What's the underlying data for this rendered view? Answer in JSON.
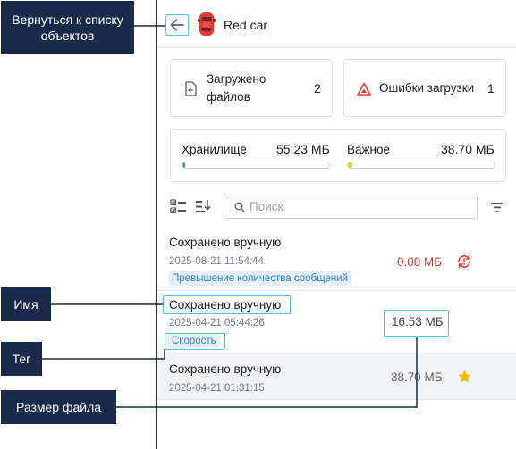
{
  "header": {
    "title": "Red car",
    "back_icon": "arrow-left-icon",
    "object_icon": "red-car-icon"
  },
  "stats": {
    "uploaded": {
      "label": "Загружено файлов",
      "count": "2",
      "icon": "file-upload-icon"
    },
    "errors": {
      "label": "Ошибки загрузки",
      "count": "1",
      "icon": "warning-triangle-icon"
    }
  },
  "storage": {
    "main": {
      "label": "Хранилище",
      "value": "55.23 МБ",
      "fill_fraction": 0.02,
      "color": "#4caf50"
    },
    "important": {
      "label": "Важное",
      "value": "38.70 МБ",
      "fill_fraction": 0.03,
      "color": "#f5c518"
    }
  },
  "toolbar": {
    "search_placeholder": "Поиск",
    "select_icon": "checklist-icon",
    "sort_icon": "sort-down-icon",
    "filter_icon": "filter-icon"
  },
  "files": [
    {
      "name": "Сохранено вручную",
      "date": "2025-08-21 11:54:44",
      "tag": "Превышение количества сообщений",
      "size": "0.00 МБ",
      "size_color": "#e53935",
      "action_icon": "retry-icon"
    },
    {
      "name": "Сохранено вручную",
      "date": "2025-04-21 05:44:26",
      "tag": "Скорость",
      "size": "16.53 МБ",
      "size_color": "#424242"
    },
    {
      "name": "Сохранено вручную",
      "date": "2025-04-21 01:31:15",
      "size": "38.70 МБ",
      "size_color": "#616161",
      "action_icon": "star-icon"
    }
  ],
  "callouts": {
    "back": "Вернуться к списку объектов",
    "name": "Имя",
    "tag": "Тег",
    "size": "Размер файла"
  },
  "colors": {
    "accent": "#4fc3e7",
    "callout_bg": "#1a2b4a",
    "error": "#e53935",
    "star": "#f5b800"
  }
}
